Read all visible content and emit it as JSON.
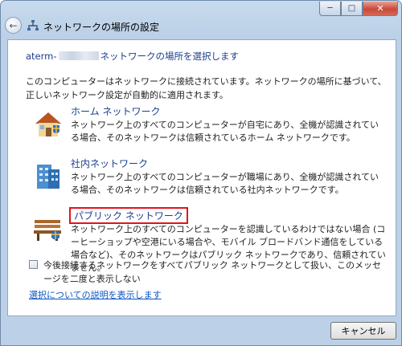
{
  "window": {
    "title": "ネットワークの場所の設定",
    "controls": {
      "minimize": "─",
      "maximize": "□",
      "close": "✕"
    },
    "back": "←"
  },
  "heading": {
    "prefix": "aterm-",
    "suffix": "ネットワークの場所を選択します"
  },
  "description": "このコンピューターはネットワークに接続されています。ネットワークの場所に基づいて、正しいネットワーク設定が自動的に適用されます。",
  "options": [
    {
      "title": "ホーム ネットワーク",
      "description": "ネットワーク上のすべてのコンピューターが自宅にあり、全機が認識されている場合、そのネットワークは信頼されているホーム ネットワークです。",
      "icon": "home-icon"
    },
    {
      "title": "社内ネットワーク",
      "description": "ネットワーク上のすべてのコンピューターが職場にあり、全機が認識されている場合、そのネットワークは信頼されている社内ネットワークです。",
      "icon": "office-building-icon"
    },
    {
      "title": "パブリック ネットワーク",
      "description": "ネットワーク上のすべてのコンピューターを認識しているわけではない場合 (コーヒーショップや空港にいる場合や、モバイル ブロードバンド通信をしている場合など)、そのネットワークはパブリック ネットワークであり、信頼されていません。",
      "icon": "park-bench-icon"
    }
  ],
  "checkbox": {
    "label": "今後接続するネットワークをすべてパブリック ネットワークとして扱い、このメッセージを二度と表示しない"
  },
  "help_link": "選択についての説明を表示します",
  "footer": {
    "cancel_label": "キャンセル"
  },
  "colors": {
    "highlight_box": "#e0141d",
    "heading_text": "#1a3e8c",
    "link": "#0b55c4"
  }
}
